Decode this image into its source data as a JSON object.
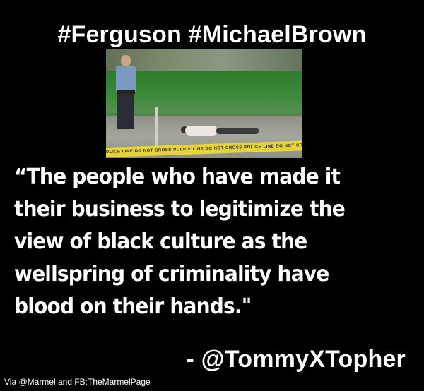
{
  "header": {
    "hashtags": "#Ferguson #MichaelBrown"
  },
  "photo": {
    "tape_text": "POLICE LINE DO NOT CROSS"
  },
  "quote": {
    "lines": [
      "“The people who have made it",
      "their business to legitimize the",
      "view of black culture as the",
      "wellspring of criminality have",
      "blood on their hands.\""
    ]
  },
  "attribution": "- @TommyXTopher",
  "credit": "Via @Marmel and FB:TheMarmelPage"
}
